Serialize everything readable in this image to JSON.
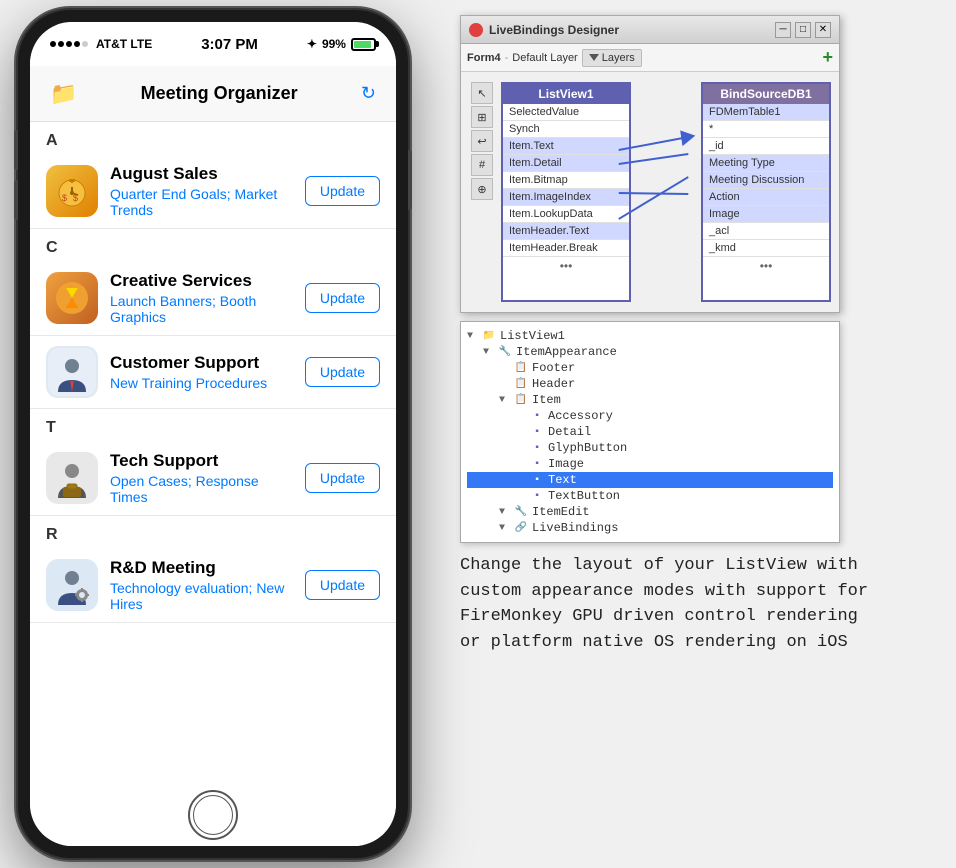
{
  "phone": {
    "status": {
      "carrier": "AT&T  LTE",
      "time": "3:07 PM",
      "bluetooth": "✦",
      "battery_pct": "99%"
    },
    "nav": {
      "title": "Meeting Organizer"
    },
    "sections": [
      {
        "letter": "A",
        "items": [
          {
            "title": "August Sales",
            "detail": "Quarter End Goals; Market Trends",
            "btn": "Update",
            "icon_type": "stopwatch"
          }
        ]
      },
      {
        "letter": "C",
        "items": [
          {
            "title": "Creative Services",
            "detail": "Launch Banners; Booth Graphics",
            "btn": "Update",
            "icon_type": "hourglass"
          },
          {
            "title": "Customer Support",
            "detail": "New Training Procedures",
            "btn": "Update",
            "icon_type": "support"
          }
        ]
      },
      {
        "letter": "T",
        "items": [
          {
            "title": "Tech Support",
            "detail": "Open Cases; Response Times",
            "btn": "Update",
            "icon_type": "techsupport"
          }
        ]
      },
      {
        "letter": "R",
        "items": [
          {
            "title": "R&D Meeting",
            "detail": "Technology evaluation; New Hires",
            "btn": "Update",
            "icon_type": "rd"
          }
        ]
      }
    ]
  },
  "designer": {
    "title": "LiveBindings Designer",
    "toolbar": {
      "form_label": "Form4",
      "layer_label": "Default Layer",
      "layers_btn": "Layers"
    },
    "listview_table": {
      "header": "ListView1",
      "rows": [
        "SelectedValue",
        "Synch",
        "Item.Text",
        "Item.Detail",
        "Item.Bitmap",
        "Item.ImageIndex",
        "Item.LookupData",
        "ItemHeader.Text",
        "ItemHeader.Break"
      ],
      "more": "..."
    },
    "bindsource_table": {
      "header": "BindSourceDB1",
      "rows": [
        "FDMemTable1",
        "*",
        "_id",
        "Meeting Type",
        "Meeting Discussion",
        "Action",
        "Image",
        "_acl",
        "_kmd"
      ],
      "more": "..."
    },
    "connected_pairs": [
      {
        "from": "Item.Text",
        "to": "Meeting Type"
      },
      {
        "from": "Item.Detail",
        "to": "Meeting Discussion"
      },
      {
        "from": "Item.ImageIndex",
        "to": "Image"
      },
      {
        "from": "ItemHeader.Text",
        "to": "Action"
      }
    ]
  },
  "tree": {
    "nodes": [
      {
        "indent": 0,
        "expand": "▼",
        "icon": "folder",
        "label": "ListView1"
      },
      {
        "indent": 1,
        "expand": "▼",
        "icon": "component",
        "label": "ItemAppearance"
      },
      {
        "indent": 2,
        "expand": " ",
        "icon": "item",
        "label": "Footer"
      },
      {
        "indent": 2,
        "expand": " ",
        "icon": "item",
        "label": "Header"
      },
      {
        "indent": 2,
        "expand": "▼",
        "icon": "item",
        "label": "Item"
      },
      {
        "indent": 3,
        "expand": " ",
        "icon": "item",
        "label": "Accessory"
      },
      {
        "indent": 3,
        "expand": " ",
        "icon": "item",
        "label": "Detail"
      },
      {
        "indent": 3,
        "expand": " ",
        "icon": "item",
        "label": "GlyphButton"
      },
      {
        "indent": 3,
        "expand": " ",
        "icon": "item",
        "label": "Image"
      },
      {
        "indent": 3,
        "expand": " ",
        "icon": "item",
        "label": "Text",
        "selected": true
      },
      {
        "indent": 3,
        "expand": " ",
        "icon": "item",
        "label": "TextButton"
      },
      {
        "indent": 2,
        "expand": "▼",
        "icon": "component",
        "label": "ItemEdit"
      },
      {
        "indent": 2,
        "expand": "▼",
        "icon": "component",
        "label": "LiveBindings"
      }
    ]
  },
  "caption": {
    "lines": [
      "Change the layout of your ListView with",
      "custom appearance modes with support for",
      "FireMonkey GPU driven control rendering",
      "or platform native OS rendering on iOS"
    ]
  }
}
